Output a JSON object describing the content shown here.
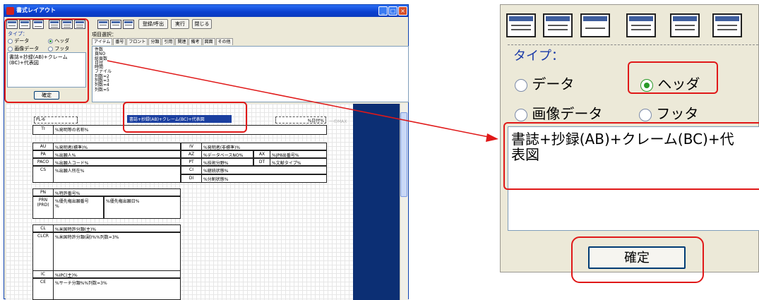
{
  "window": {
    "title": "書式レイアウト",
    "buttons": {
      "minimize": "_",
      "maximize": "□",
      "close": "×"
    }
  },
  "toolbar": {
    "save_load_label": "登録/呼出",
    "run_label": "実行",
    "close_label": "閉じる"
  },
  "type_panel": {
    "label": "タイプ：",
    "options": {
      "data": "データ",
      "header": "ヘッダ",
      "image_data": "画像データ",
      "footer": "フッタ"
    },
    "selected": "header",
    "text": "書誌+抄録(AB)+クレーム(BC)+代表図",
    "text_line1": "書誌+抄録(AB)+クレーム(BC)+代",
    "text_line2": "表図",
    "confirm_label": "確定"
  },
  "item_select": {
    "label": "項目選択：",
    "tabs": [
      "アイテム",
      "番号",
      "フロント",
      "分類",
      "引用",
      "関連",
      "備考",
      "図面",
      "その他"
    ],
    "items": [
      "件数",
      "頁NO",
      "総頁数",
      "日付",
      "時間",
      "ファイル",
      "列数=2",
      "列数=3",
      "列数=4",
      "列数=5"
    ]
  },
  "canvas": {
    "page_label": "PL-6",
    "header_text": "書誌+抄録(AB)+クレーム(BC)+代表図",
    "date_field": "%日付%",
    "side_note": "ーのMAX",
    "rows": {
      "ti": {
        "label": "TI",
        "value": "%発明等の名称%"
      },
      "au": {
        "label": "AU",
        "value": "%発明者(標準)%"
      },
      "iv": {
        "label": "IV",
        "value": "%発明者(非標準)%"
      },
      "pa": {
        "label": "PA",
        "value": "%出願人%"
      },
      "az": {
        "label": "AZ",
        "value": "%データベースNO%"
      },
      "ax": {
        "label": "AX",
        "value": "%JP8出番号%"
      },
      "paco": {
        "label": "PACO",
        "value": "%出願人コード%"
      },
      "pt": {
        "label": "PT",
        "value": "%技術分野%"
      },
      "dt": {
        "label": "DT",
        "value": "%文献タイプ%"
      },
      "cs": {
        "label": "CS",
        "value": "%出願人所在%"
      },
      "ci": {
        "label": "CI",
        "value": "%継続状態%"
      },
      "di": {
        "label": "DI",
        "value": "%分割状態%"
      },
      "pn": {
        "label": "PN",
        "value": "%特許番号%"
      },
      "prn": {
        "label": "PRN\n(PRD)",
        "value1": "%優先権出願番号\n%",
        "value2": "%優先権出願日%"
      },
      "cl": {
        "label": "CL",
        "value": "%米国特許分類(主)%"
      },
      "clcr": {
        "label": "CLCR",
        "value": "%米国特許分類(副)%%列数=3%"
      },
      "ic": {
        "label": "IC",
        "value": "%IPC(主)%"
      },
      "ce": {
        "label": "CE",
        "value": "%サーチ分類%%列数=3%"
      }
    }
  },
  "colors": {
    "annotation_red": "#e01818",
    "title_blue": "#0a3fcf",
    "radio_green": "#2a9a2a",
    "header_blue": "#1b3fa0"
  }
}
